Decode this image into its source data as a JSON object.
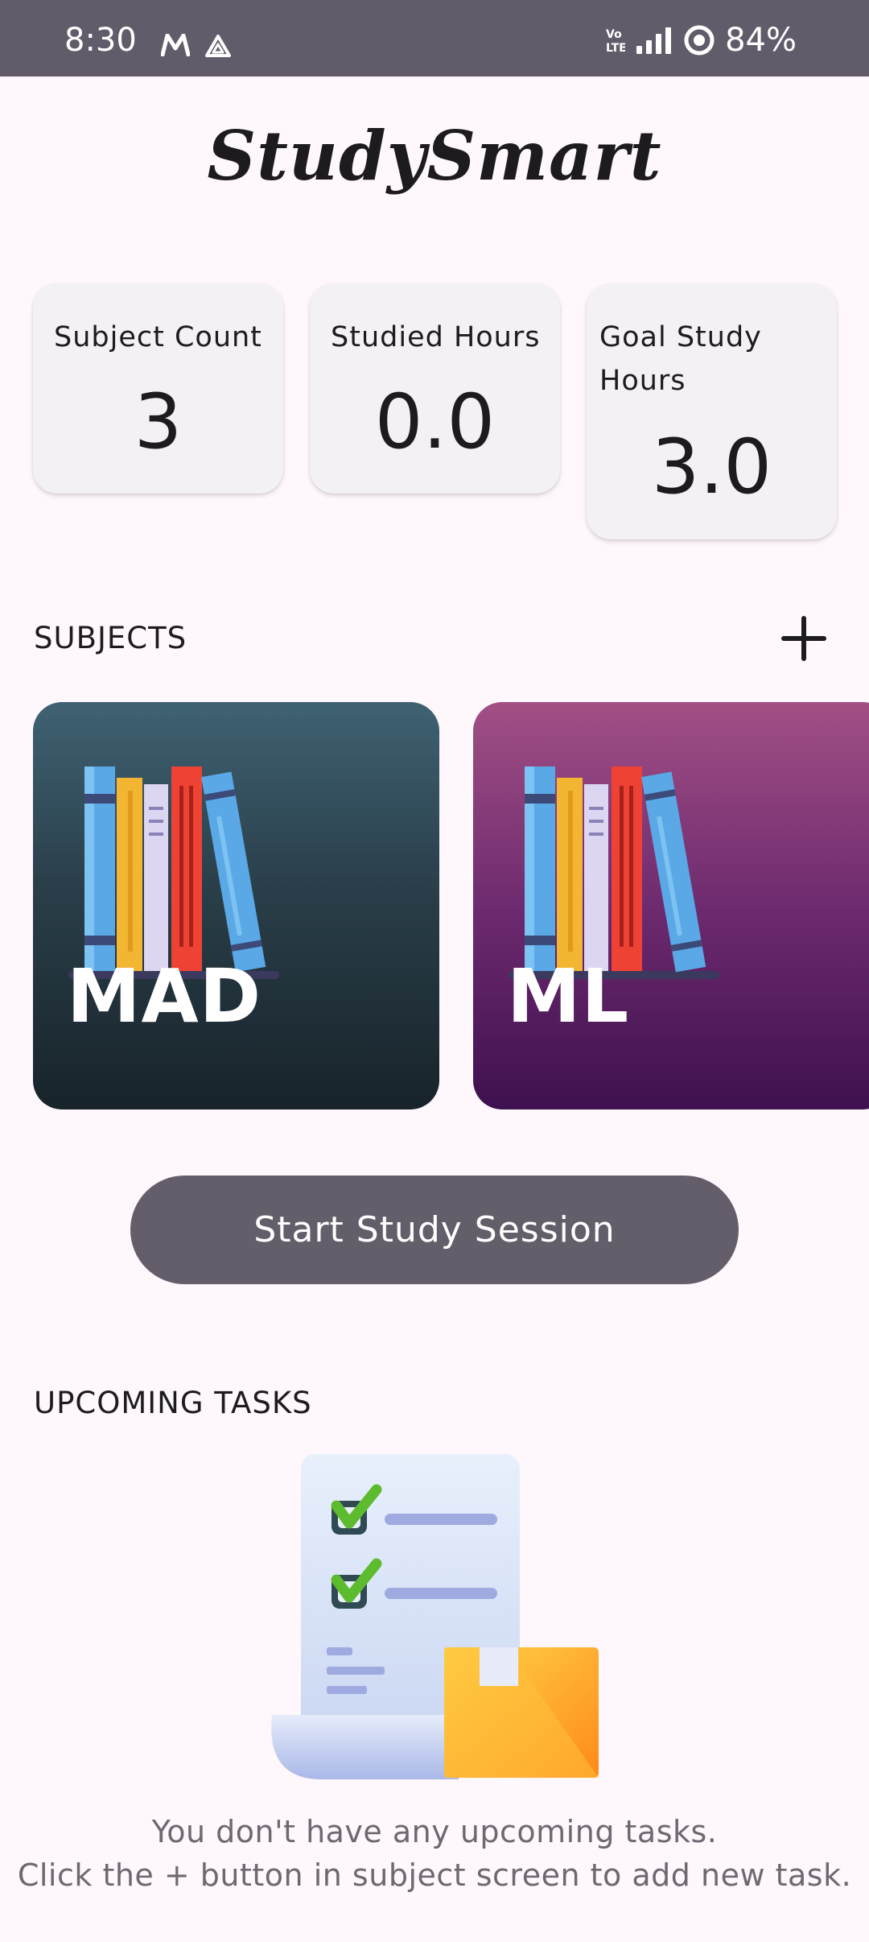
{
  "status_bar": {
    "time": "8:30",
    "left_icons": [
      "m-logo-icon",
      "drive-icon"
    ],
    "right_icons": [
      "volte-icon",
      "signal-icon",
      "data-saver-icon"
    ],
    "battery": "84%"
  },
  "app": {
    "title": "StudySmart"
  },
  "stats": [
    {
      "label": "Subject Count",
      "value": "3"
    },
    {
      "label": "Studied Hours",
      "value": "0.0"
    },
    {
      "label": "Goal Study Hours",
      "value": "3.0"
    }
  ],
  "subjects_section": {
    "title": "SUBJECTS",
    "add_icon": "plus-icon"
  },
  "subjects": [
    {
      "name": "MAD",
      "color": "#2A3F4A"
    },
    {
      "name": "ML",
      "color": "#6E2B6F"
    }
  ],
  "start_button": {
    "label": "Start Study Session",
    "color": "#645E6A"
  },
  "tasks_section": {
    "title": "UPCOMING TASKS",
    "empty_line1": "You don't have any upcoming tasks.",
    "empty_line2": "Click the + button in subject screen to add new task."
  }
}
